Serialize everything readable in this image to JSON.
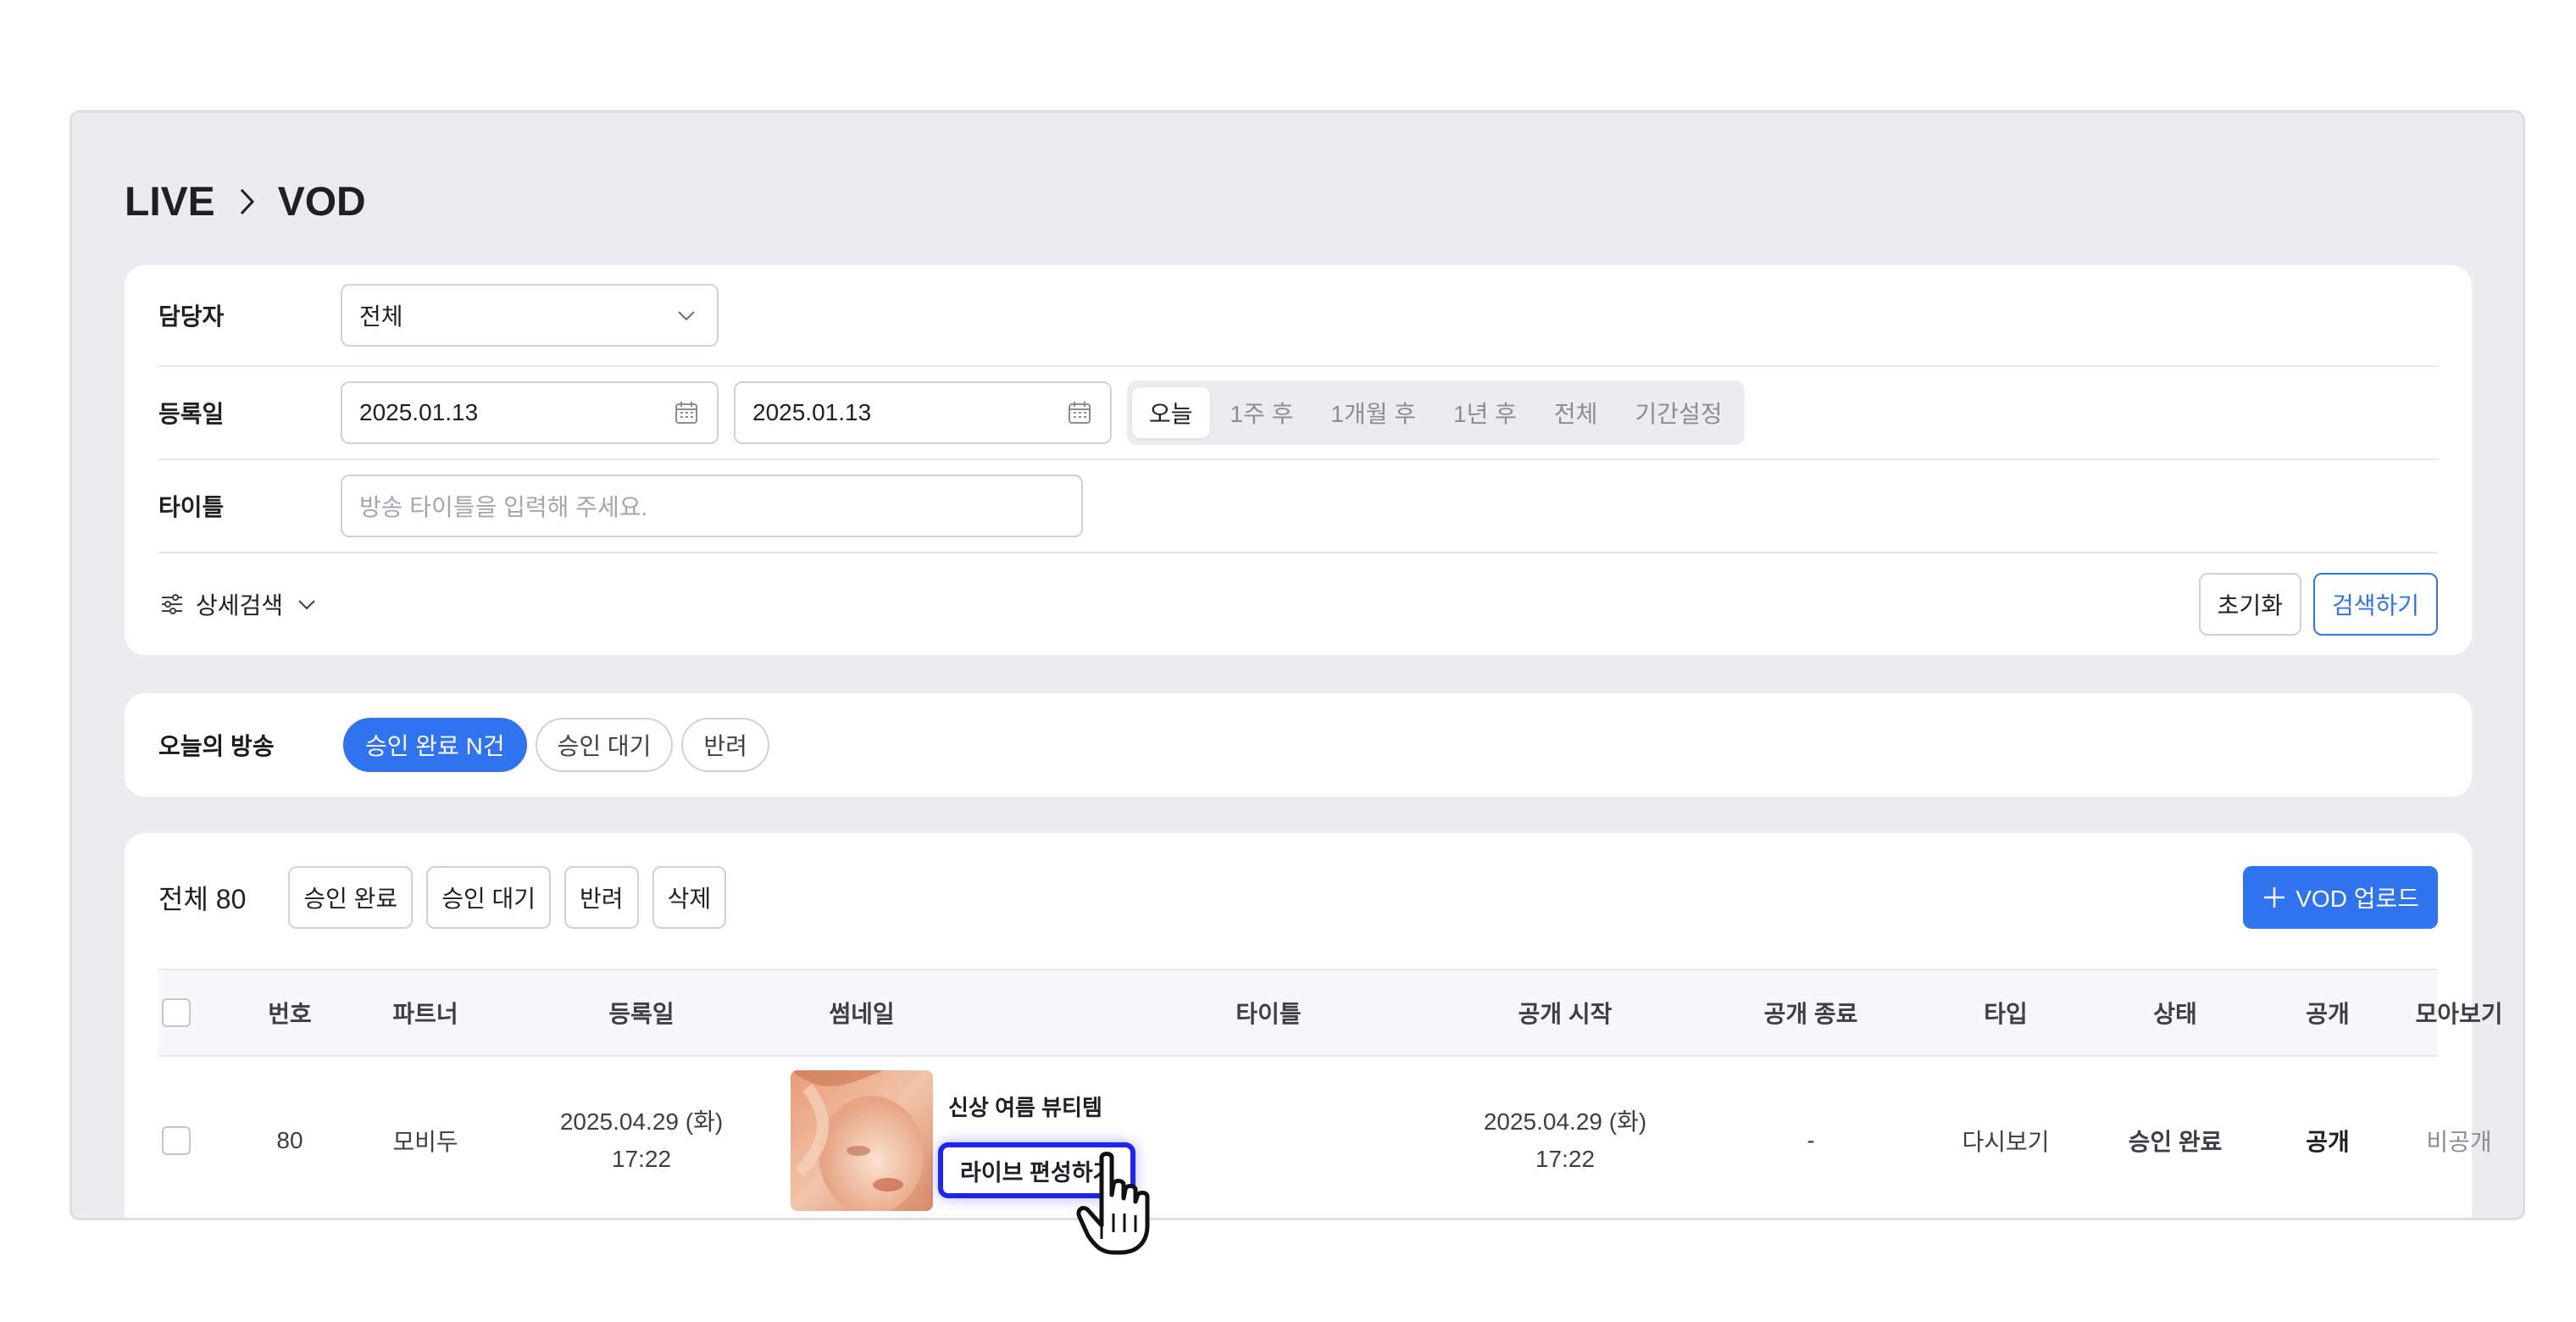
{
  "breadcrumb": {
    "root": "LIVE",
    "current": "VOD"
  },
  "filters": {
    "manager_label": "담당자",
    "manager_value": "전체",
    "date_label": "등록일",
    "date_from": "2025.01.13",
    "date_to": "2025.01.13",
    "period_options": [
      "오늘",
      "1주 후",
      "1개월 후",
      "1년 후",
      "전체",
      "기간설정"
    ],
    "period_selected": "오늘",
    "title_label": "타이틀",
    "title_placeholder": "방송 타이틀을 입력해 주세요.",
    "advanced_label": "상세검색",
    "reset_label": "초기화",
    "search_label": "검색하기"
  },
  "today": {
    "label": "오늘의 방송",
    "pills": [
      "승인 완료 N건",
      "승인 대기",
      "반려"
    ],
    "pill_selected": "승인 완료 N건"
  },
  "list": {
    "total_label": "전체",
    "total_count": "80",
    "actions": [
      "승인 완료",
      "승인 대기",
      "반려",
      "삭제"
    ],
    "upload_label": "VOD 업로드",
    "columns": [
      "번호",
      "파트너",
      "등록일",
      "썸네일",
      "타이틀",
      "공개 시작",
      "공개 종료",
      "타입",
      "상태",
      "공개",
      "모아보기"
    ],
    "rows": [
      {
        "no": "80",
        "partner": "모비두",
        "reg_date": "2025.04.29 (화)",
        "reg_time": "17:22",
        "title": "신상 여름 뷰티템",
        "live_edit": "라이브 편성하기",
        "open_start_date": "2025.04.29 (화)",
        "open_start_time": "17:22",
        "open_end": "-",
        "type": "다시보기",
        "status": "승인 완료",
        "public": "공개",
        "collection": "비공개"
      }
    ]
  },
  "colors": {
    "primary": "#2f73ee",
    "success": "#6cc63b",
    "highlight": "#1f25ea"
  }
}
